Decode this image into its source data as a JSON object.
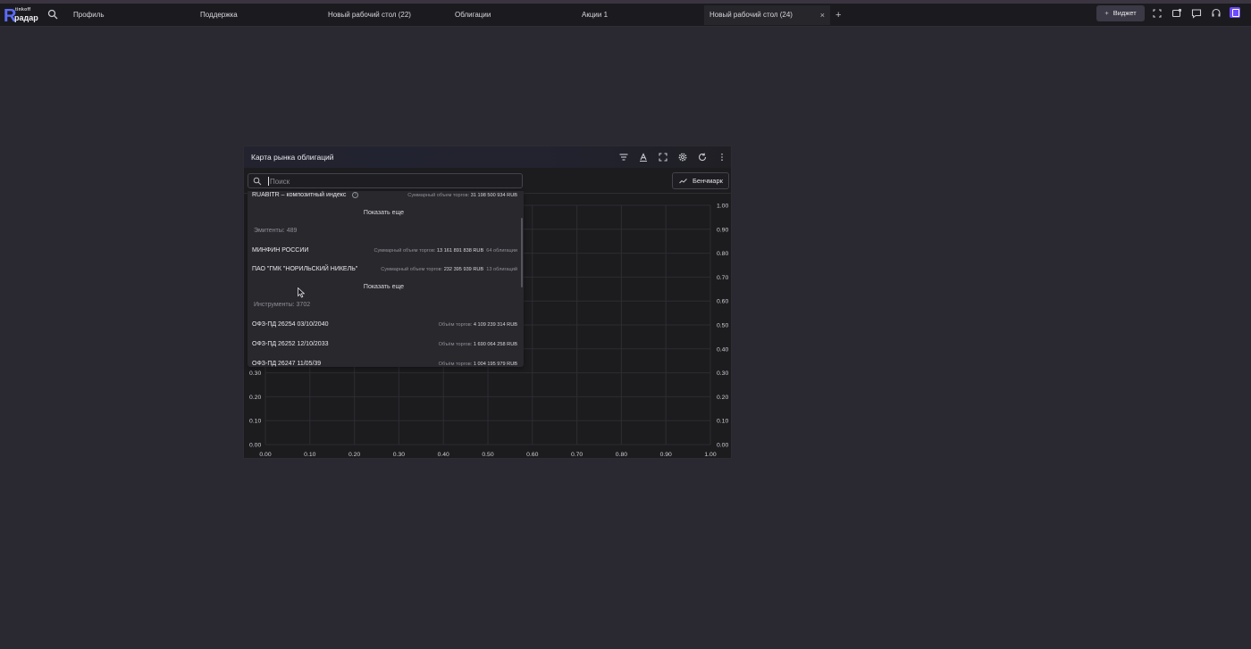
{
  "topbar": {
    "logo_small": "tinkoff",
    "logo_word": "радар",
    "tabs": [
      {
        "label": "Профиль"
      },
      {
        "label": "Поддержка"
      },
      {
        "label": "Новый рабочий стол (22)"
      },
      {
        "label": "Облигации"
      },
      {
        "label": "Акции 1"
      },
      {
        "label": "Новый рабочий стол (24)",
        "active": true
      }
    ],
    "add_tab": "+",
    "widget_button": "Виджет",
    "close_glyph": "×"
  },
  "widget": {
    "title": "Карта рынка облигаций",
    "search_placeholder": "Поиск",
    "benchmark_label": "Бенчмарк"
  },
  "dropdown": {
    "index_row": {
      "name": "RUABITR – композитный индекс",
      "right_label": "Суммарный объем торгов:",
      "right_value": "31 198 500 934 RUB"
    },
    "show_more": "Показать еще",
    "issuers_header": "Эмитенты: 489",
    "issuers": [
      {
        "name": "МИНФИН РОССИИ",
        "label": "Суммарный объем торгов:",
        "value": "13 161 891 838 RUB",
        "count": "64 облигации"
      },
      {
        "name": "ПАО \"ГМК \"НОРИЛЬСКИЙ НИКЕЛЬ\"",
        "label": "Суммарный объем торгов:",
        "value": "232 395 939 RUB",
        "count": "13 облигаций"
      }
    ],
    "instruments_header": "Инструменты: 3702",
    "instruments": [
      {
        "name": "ОФЗ-ПД 26254 03/10/2040",
        "label": "Объём торгов:",
        "value": "4 109 239 314 RUB"
      },
      {
        "name": "ОФЗ-ПД 26252 12/10/2033",
        "label": "Объём торгов:",
        "value": "1 690 064 258 RUB"
      },
      {
        "name": "ОФЗ-ПД 26247 11/05/39",
        "label": "Объём торгов:",
        "value": "1 004 195 979 RUB"
      }
    ]
  },
  "chart_data": {
    "type": "scatter",
    "title": "",
    "xlabel": "",
    "ylabel": "",
    "xlim": [
      0,
      1
    ],
    "ylim": [
      0,
      1
    ],
    "x_ticks": [
      "0.00",
      "0.10",
      "0.20",
      "0.30",
      "0.40",
      "0.50",
      "0.60",
      "0.70",
      "0.80",
      "0.90",
      "1.00"
    ],
    "y_ticks_right": [
      "0.00",
      "0.10",
      "0.20",
      "0.30",
      "0.40",
      "0.50",
      "0.60",
      "0.70",
      "0.80",
      "0.90",
      "1.00"
    ],
    "y_ticks_left_visible": [
      "0.00",
      "0.10",
      "0.20",
      "0.30"
    ],
    "grid": true,
    "series": []
  },
  "colors": {
    "background": "#2a2830",
    "topbar": "#1b1b1f",
    "widget": "#1c1c1f",
    "accent": "#5b6cff",
    "grid": "#2d2d32"
  }
}
